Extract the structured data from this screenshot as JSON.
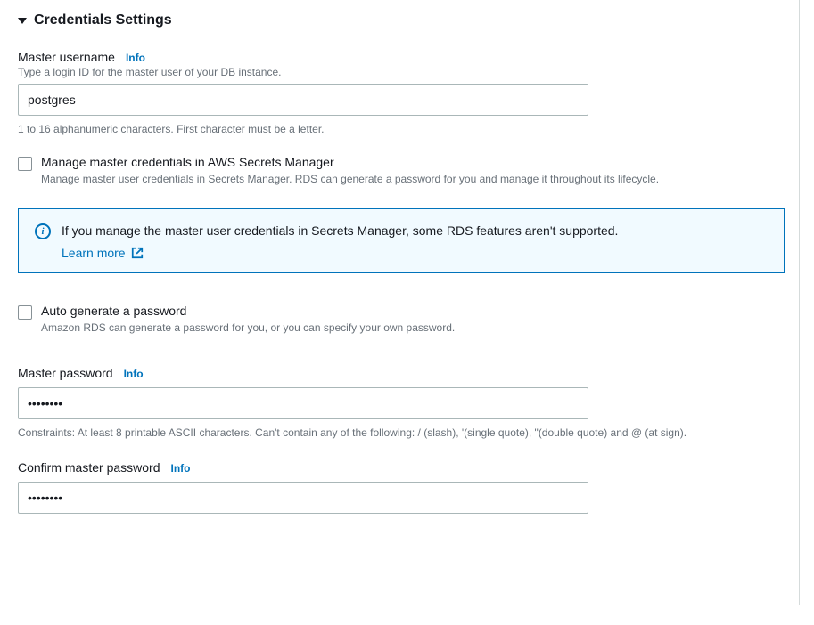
{
  "section": {
    "title": "Credentials Settings"
  },
  "masterUsername": {
    "label": "Master username",
    "info": "Info",
    "description": "Type a login ID for the master user of your DB instance.",
    "value": "postgres",
    "hint": "1 to 16 alphanumeric characters. First character must be a letter."
  },
  "secretsManager": {
    "label": "Manage master credentials in AWS Secrets Manager",
    "description": "Manage master user credentials in Secrets Manager. RDS can generate a password for you and manage it throughout its lifecycle."
  },
  "infoBanner": {
    "text": "If you manage the master user credentials in Secrets Manager, some RDS features aren't supported.",
    "learnMore": "Learn more"
  },
  "autoGenerate": {
    "label": "Auto generate a password",
    "description": "Amazon RDS can generate a password for you, or you can specify your own password."
  },
  "masterPassword": {
    "label": "Master password",
    "info": "Info",
    "value": "••••••••",
    "hint": "Constraints: At least 8 printable ASCII characters. Can't contain any of the following: / (slash), '(single quote), \"(double quote) and @ (at sign)."
  },
  "confirmPassword": {
    "label": "Confirm master password",
    "info": "Info",
    "value": "••••••••"
  }
}
